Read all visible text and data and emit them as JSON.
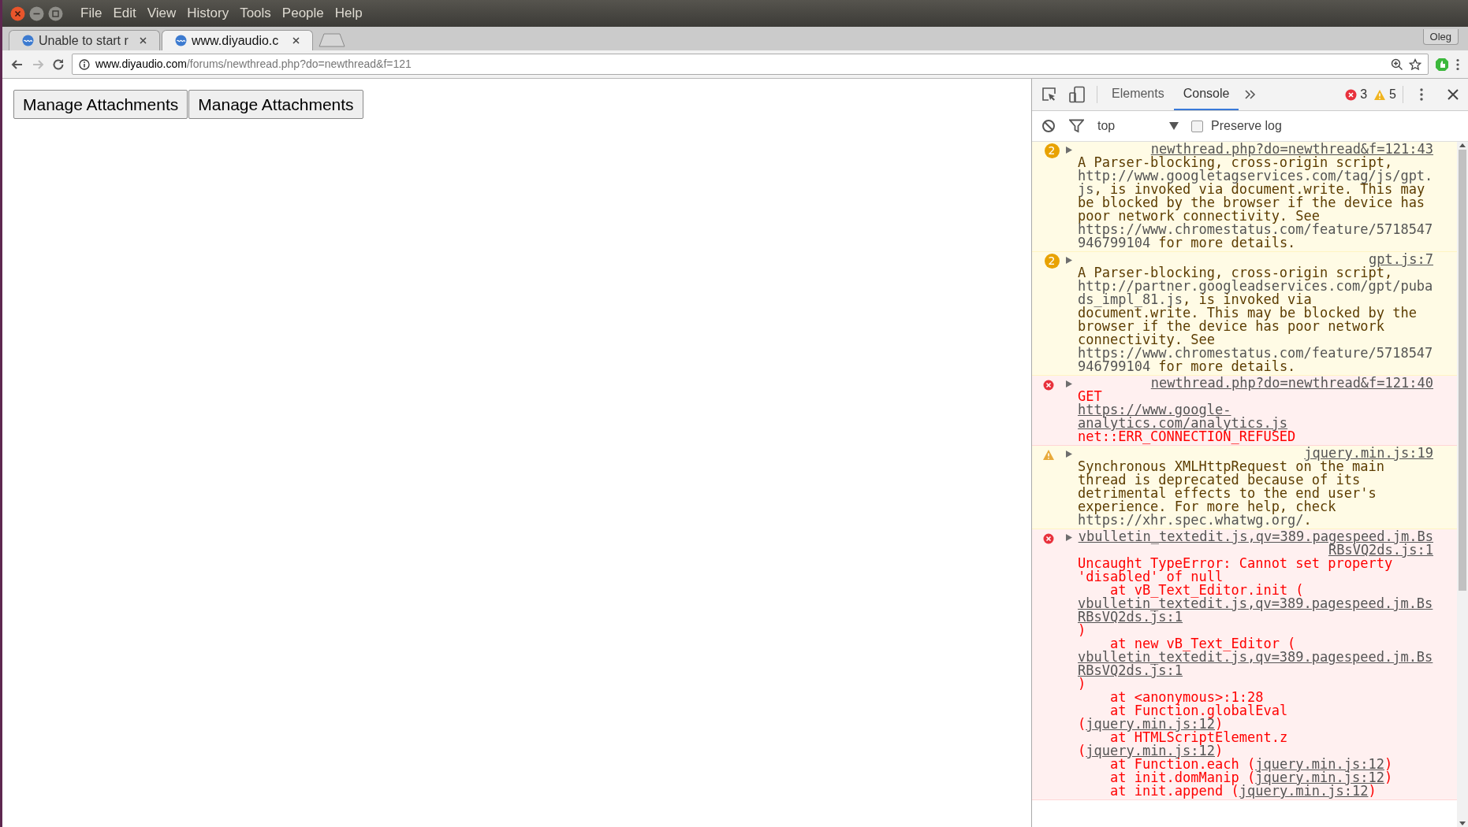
{
  "menu_bar": {
    "items": [
      "File",
      "Edit",
      "View",
      "History",
      "Tools",
      "People",
      "Help"
    ]
  },
  "tabs": [
    {
      "title": "Unable to start r",
      "selected": false
    },
    {
      "title": "www.diyaudio.c",
      "selected": true
    }
  ],
  "profile": "Oleg",
  "address_bar": {
    "host": "www.diyaudio.com",
    "path": "/forums/newthread.php?do=newthread&f=121"
  },
  "page": {
    "buttons": [
      "Manage Attachments",
      "Manage Attachments"
    ]
  },
  "devtools": {
    "panels": [
      {
        "label": "Elements",
        "selected": false
      },
      {
        "label": "Console",
        "selected": true
      }
    ],
    "error_count": "3",
    "warning_count": "5",
    "context": "top",
    "preserve_log": {
      "label": "Preserve log",
      "checked": false
    },
    "messages": [
      {
        "kind": "warning",
        "count": "2",
        "source": "newthread.php?do=newthread&f=121:43",
        "parts": [
          {
            "kind": "text",
            "text": "A Parser-blocking, cross-origin script, "
          },
          {
            "kind": "url",
            "text": "http://www.googletagservices.com/tag/js/gpt.js"
          },
          {
            "kind": "text",
            "text": ", is invoked via document.write. This may be blocked by the browser if the device has poor network connectivity. See "
          },
          {
            "kind": "url",
            "text": "https://www.chromestatus.com/feature/5718547946799104"
          },
          {
            "kind": "text",
            "text": " for more details."
          }
        ]
      },
      {
        "kind": "warning",
        "count": "2",
        "source": "gpt.js:7",
        "parts": [
          {
            "kind": "text",
            "text": "A Parser-blocking, cross-origin script, "
          },
          {
            "kind": "url",
            "text": "http://partner.googleadservices.com/gpt/pubads_impl_81.js"
          },
          {
            "kind": "text",
            "text": ", is invoked via document.write. This may be blocked by the browser if the device has poor network connectivity. See "
          },
          {
            "kind": "url",
            "text": "https://www.chromestatus.com/feature/5718547946799104"
          },
          {
            "kind": "text",
            "text": " for more details."
          }
        ]
      },
      {
        "kind": "error",
        "source": "newthread.php?do=newthread&f=121:40",
        "parts": [
          {
            "kind": "text",
            "text": "GET "
          },
          {
            "kind": "link",
            "text": "https://www.google-analytics.com/analytics.js"
          },
          {
            "kind": "text",
            "text": " net::ERR_CONNECTION_REFUSED"
          }
        ]
      },
      {
        "kind": "warning",
        "source": "jquery.min.js:19",
        "parts": [
          {
            "kind": "text",
            "text": "Synchronous XMLHttpRequest on the main thread is deprecated because of its detrimental effects to the end user's experience. For more help, check "
          },
          {
            "kind": "url",
            "text": "https://xhr.spec.whatwg.org/"
          },
          {
            "kind": "text",
            "text": "."
          }
        ]
      },
      {
        "kind": "error",
        "source": "vbulletin_textedit.js,qv=389.pagespeed.jm.BsRBsVQ2ds.js:1",
        "parts": [
          {
            "kind": "text",
            "text": "Uncaught TypeError: Cannot set property 'disabled' of null\n    at vB_Text_Editor.init ("
          },
          {
            "kind": "link",
            "text": "vbulletin_textedit.js,qv=389.pagespeed.jm.BsRBsVQ2ds.js:1"
          },
          {
            "kind": "text",
            "text": ")\n    at new vB_Text_Editor ("
          },
          {
            "kind": "link",
            "text": "vbulletin_textedit.js,qv=389.pagespeed.jm.BsRBsVQ2ds.js:1"
          },
          {
            "kind": "text",
            "text": ")\n    at <anonymous>:1:28\n    at Function.globalEval ("
          },
          {
            "kind": "link",
            "text": "jquery.min.js:12"
          },
          {
            "kind": "text",
            "text": ")\n    at HTMLScriptElement.z ("
          },
          {
            "kind": "link",
            "text": "jquery.min.js:12"
          },
          {
            "kind": "text",
            "text": ")\n    at Function.each ("
          },
          {
            "kind": "link",
            "text": "jquery.min.js:12"
          },
          {
            "kind": "text",
            "text": ")\n    at init.domManip ("
          },
          {
            "kind": "link",
            "text": "jquery.min.js:12"
          },
          {
            "kind": "text",
            "text": ")\n    at init.append ("
          },
          {
            "kind": "link",
            "text": "jquery.min.js:12"
          },
          {
            "kind": "text",
            "text": ")"
          }
        ]
      }
    ]
  }
}
